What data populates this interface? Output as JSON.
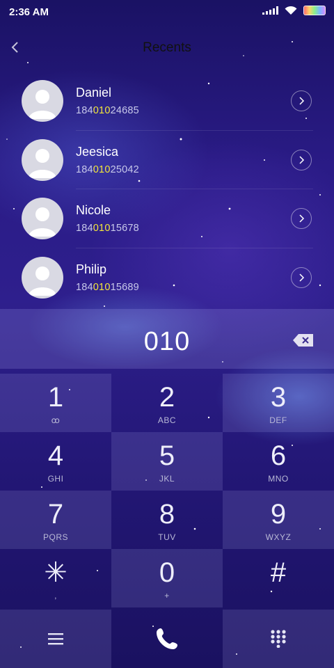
{
  "status_bar": {
    "time": "2:36 AM"
  },
  "header": {
    "title": "Recents"
  },
  "recents": [
    {
      "name": "Daniel",
      "number_prefix": "184",
      "number_match": "010",
      "number_suffix": "24685"
    },
    {
      "name": "Jeesica",
      "number_prefix": "184",
      "number_match": "010",
      "number_suffix": "25042"
    },
    {
      "name": "Nicole",
      "number_prefix": "184",
      "number_match": "010",
      "number_suffix": "15678"
    },
    {
      "name": "Philip",
      "number_prefix": "184",
      "number_match": "010",
      "number_suffix": "15689"
    }
  ],
  "dialer": {
    "input": "010"
  },
  "keys": [
    {
      "digit": "1",
      "letters": "ꝏ"
    },
    {
      "digit": "2",
      "letters": "ABC"
    },
    {
      "digit": "3",
      "letters": "DEF"
    },
    {
      "digit": "4",
      "letters": "GHI"
    },
    {
      "digit": "5",
      "letters": "JKL"
    },
    {
      "digit": "6",
      "letters": "MNO"
    },
    {
      "digit": "7",
      "letters": "PQRS"
    },
    {
      "digit": "8",
      "letters": "TUV"
    },
    {
      "digit": "9",
      "letters": "WXYZ"
    },
    {
      "digit": "✳",
      "letters": ","
    },
    {
      "digit": "0",
      "letters": "+"
    },
    {
      "digit": "#",
      "letters": ""
    }
  ],
  "colors": {
    "highlight": "#f3e63a",
    "background": "#2a1b86"
  },
  "icons": {
    "status": [
      "signal-icon",
      "wifi-icon",
      "battery-icon"
    ],
    "bottom": [
      "menu-icon",
      "call-icon",
      "dialpad-icon"
    ]
  }
}
